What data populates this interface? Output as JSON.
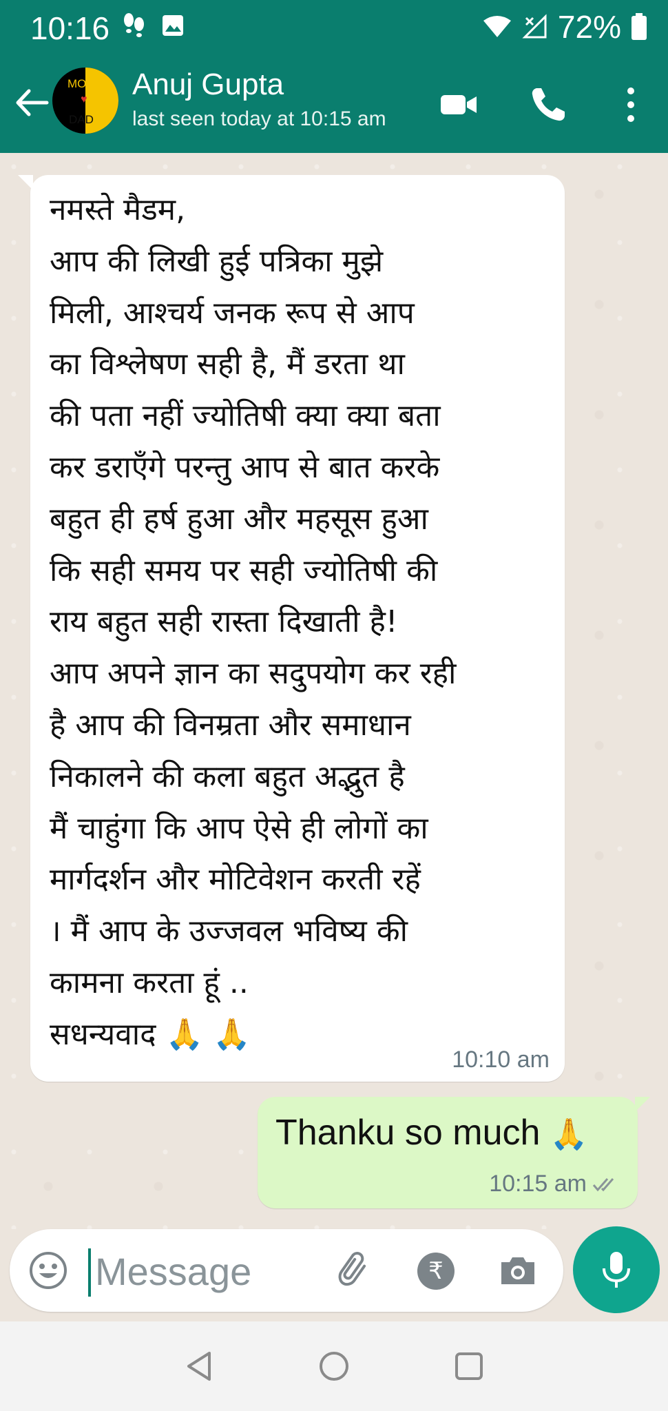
{
  "status_bar": {
    "time": "10:16",
    "battery": "72%",
    "icons": [
      "steps-icon",
      "gallery-icon",
      "wifi-icon",
      "signal-icon",
      "battery-icon"
    ]
  },
  "header": {
    "contact_name": "Anuj Gupta",
    "last_seen": "last seen today at 10:15 am",
    "avatar_text_top": "MOM",
    "avatar_text_bottom": "DAD",
    "icons": [
      "back-arrow-icon",
      "video-call-icon",
      "voice-call-icon",
      "more-options-icon"
    ],
    "header_color": "#0a7e6e"
  },
  "messages": [
    {
      "direction": "incoming",
      "text": "नमस्ते मैडम,\nआप की लिखी हुई पत्रिका मुझे\nमिली, आश्चर्य जनक  रूप  से आप\nका विश्लेषण सही है, मैं डरता था\nकी पता नहीं ज्योतिषी क्या क्या बता\nकर डराएँगे परन्तु आप से बात करके\nबहुत ही हर्ष हुआ और महसूस  हुआ\nकि सही समय पर सही ज्योतिषी की\nराय बहुत सही रास्ता दिखाती है!\nआप अपने ज्ञान का सदुपयोग कर रही\nहै आप की विनम्रता और समाधान\nनिकालने की कला बहुत अद्भुत है\nमैं चाहुंगा कि आप ऐसे ही लोगों का\nमार्गदर्शन और मोटिवेशन करती रहें\n। मैं आप के उज्जवल भविष्य की\nकामना करता हूं ..\nसधन्यवाद ",
      "emoji": "🙏 🙏",
      "time": "10:10 am"
    },
    {
      "direction": "outgoing",
      "text": "Thanku so much ",
      "emoji": "🙏",
      "time": "10:15 am",
      "read_status": "double-tick"
    }
  ],
  "input": {
    "placeholder": "Message",
    "icons": [
      "emoji-icon",
      "attach-icon",
      "rupee-icon",
      "camera-icon",
      "mic-icon"
    ],
    "rupee_symbol": "₹"
  },
  "navbar": {
    "icons": [
      "nav-back-icon",
      "nav-home-icon",
      "nav-recents-icon"
    ]
  }
}
